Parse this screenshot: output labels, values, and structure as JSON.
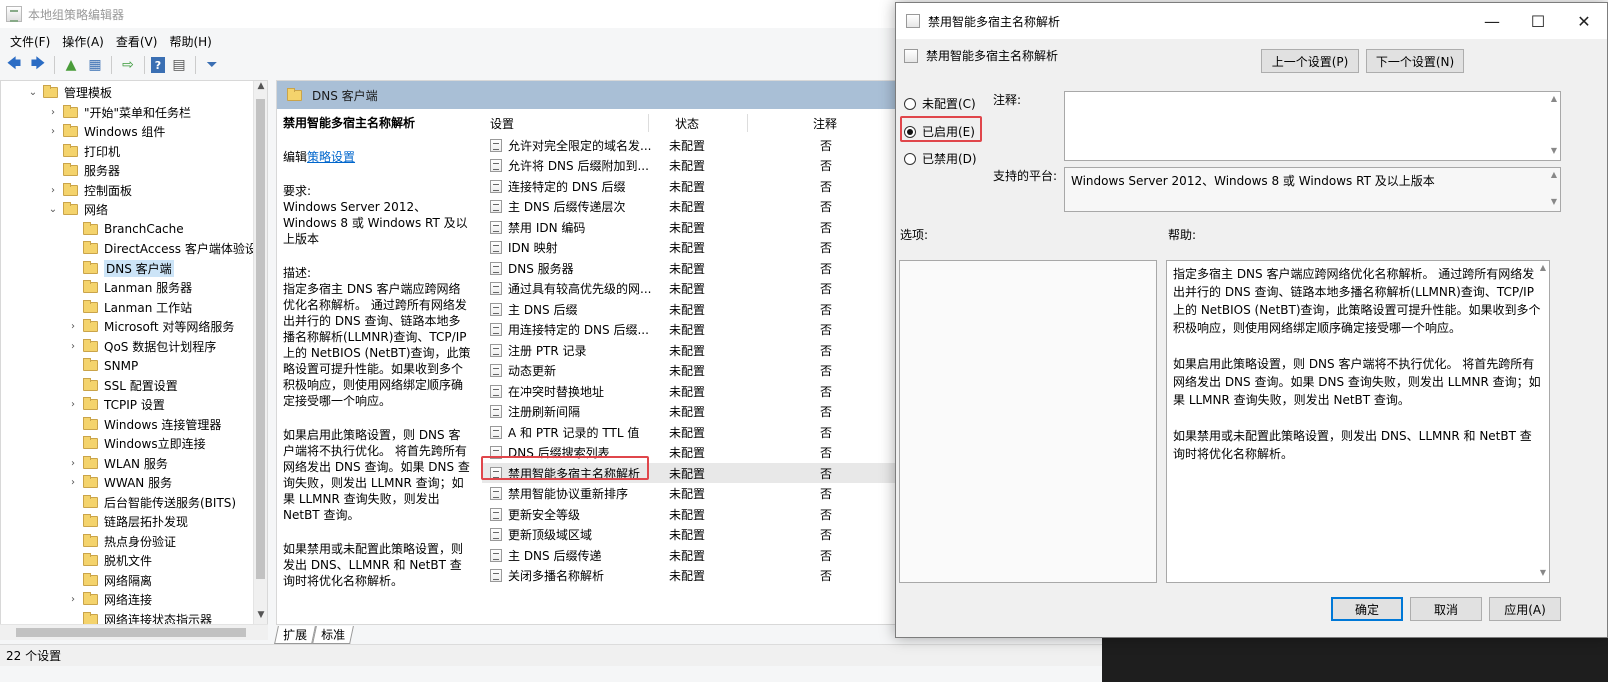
{
  "main": {
    "title": "本地组策略编辑器",
    "menu": [
      "文件(F)",
      "操作(A)",
      "查看(V)",
      "帮助(H)"
    ],
    "status": "22 个设置",
    "tabs": [
      "扩展",
      "标准"
    ]
  },
  "tree": {
    "items": [
      {
        "label": "管理模板",
        "exp": "⌄",
        "indent": 0
      },
      {
        "label": "\"开始\"菜单和任务栏",
        "exp": "›",
        "indent": 1
      },
      {
        "label": "Windows 组件",
        "exp": "›",
        "indent": 1
      },
      {
        "label": "打印机",
        "exp": "",
        "indent": 1
      },
      {
        "label": "服务器",
        "exp": "",
        "indent": 1
      },
      {
        "label": "控制面板",
        "exp": "›",
        "indent": 1
      },
      {
        "label": "网络",
        "exp": "⌄",
        "indent": 1
      },
      {
        "label": "BranchCache",
        "exp": "",
        "indent": 2
      },
      {
        "label": "DirectAccess 客户端体验设置",
        "exp": "",
        "indent": 2
      },
      {
        "label": "DNS 客户端",
        "exp": "",
        "indent": 2,
        "selected": true
      },
      {
        "label": "Lanman 服务器",
        "exp": "",
        "indent": 2
      },
      {
        "label": "Lanman 工作站",
        "exp": "",
        "indent": 2
      },
      {
        "label": "Microsoft 对等网络服务",
        "exp": "›",
        "indent": 2
      },
      {
        "label": "QoS 数据包计划程序",
        "exp": "›",
        "indent": 2
      },
      {
        "label": "SNMP",
        "exp": "",
        "indent": 2
      },
      {
        "label": "SSL 配置设置",
        "exp": "",
        "indent": 2
      },
      {
        "label": "TCPIP 设置",
        "exp": "›",
        "indent": 2
      },
      {
        "label": "Windows 连接管理器",
        "exp": "",
        "indent": 2
      },
      {
        "label": "Windows立即连接",
        "exp": "",
        "indent": 2
      },
      {
        "label": "WLAN 服务",
        "exp": "›",
        "indent": 2
      },
      {
        "label": "WWAN 服务",
        "exp": "›",
        "indent": 2
      },
      {
        "label": "后台智能传送服务(BITS)",
        "exp": "",
        "indent": 2
      },
      {
        "label": "链路层拓扑发现",
        "exp": "",
        "indent": 2
      },
      {
        "label": "热点身份验证",
        "exp": "",
        "indent": 2
      },
      {
        "label": "脱机文件",
        "exp": "",
        "indent": 2
      },
      {
        "label": "网络隔离",
        "exp": "",
        "indent": 2
      },
      {
        "label": "网络连接",
        "exp": "›",
        "indent": 2
      },
      {
        "label": "网络连接状态指示器",
        "exp": "",
        "indent": 2
      }
    ]
  },
  "content": {
    "header": "DNS 客户端",
    "desc": {
      "title": "禁用智能多宿主名称解析",
      "edit_prefix": "编辑",
      "edit_link": "策略设置",
      "req_label": "要求:",
      "req_text": "Windows Server 2012、Windows 8 或 Windows RT 及以上版本",
      "desc_label": "描述:",
      "p1": "指定多宿主 DNS 客户端应跨网络优化名称解析。 通过跨所有网络发出并行的 DNS 查询、链路本地多播名称解析(LLMNR)查询、TCP/IP 上的 NetBIOS (NetBT)查询，此策略设置可提升性能。如果收到多个积极响应，则使用网络绑定顺序确定接受哪一个响应。",
      "p2": "如果启用此策略设置，则 DNS 客户端将不执行优化。 将首先跨所有网络发出 DNS 查询。如果 DNS 查询失败，则发出 LLMNR 查询；如果 LLMNR 查询失败，则发出 NetBT 查询。",
      "p3": "如果禁用或未配置此策略设置，则发出 DNS、LLMNR 和 NetBT 查询时将优化名称解析。"
    },
    "columns": {
      "setting": "设置",
      "state": "状态",
      "note": "注释"
    },
    "rows": [
      {
        "name": "允许对完全限定的域名发...",
        "state": "未配置",
        "note": "否"
      },
      {
        "name": "允许将 DNS 后缀附加到...",
        "state": "未配置",
        "note": "否"
      },
      {
        "name": "连接特定的 DNS 后缀",
        "state": "未配置",
        "note": "否"
      },
      {
        "name": "主 DNS 后缀传递层次",
        "state": "未配置",
        "note": "否"
      },
      {
        "name": "禁用 IDN 编码",
        "state": "未配置",
        "note": "否"
      },
      {
        "name": "IDN 映射",
        "state": "未配置",
        "note": "否"
      },
      {
        "name": "DNS 服务器",
        "state": "未配置",
        "note": "否"
      },
      {
        "name": "通过具有较高优先级的网...",
        "state": "未配置",
        "note": "否"
      },
      {
        "name": "主 DNS 后缀",
        "state": "未配置",
        "note": "否"
      },
      {
        "name": "用连接特定的 DNS 后缀...",
        "state": "未配置",
        "note": "否"
      },
      {
        "name": "注册 PTR 记录",
        "state": "未配置",
        "note": "否"
      },
      {
        "name": "动态更新",
        "state": "未配置",
        "note": "否"
      },
      {
        "name": "在冲突时替换地址",
        "state": "未配置",
        "note": "否"
      },
      {
        "name": "注册刷新间隔",
        "state": "未配置",
        "note": "否"
      },
      {
        "name": "A 和 PTR 记录的 TTL 值",
        "state": "未配置",
        "note": "否"
      },
      {
        "name": "DNS 后缀搜索列表",
        "state": "未配置",
        "note": "否"
      },
      {
        "name": "禁用智能多宿主名称解析",
        "state": "未配置",
        "note": "否",
        "selected": true
      },
      {
        "name": "禁用智能协议重新排序",
        "state": "未配置",
        "note": "否"
      },
      {
        "name": "更新安全等级",
        "state": "未配置",
        "note": "否"
      },
      {
        "name": "更新顶级域区域",
        "state": "未配置",
        "note": "否"
      },
      {
        "name": "主 DNS 后缀传递",
        "state": "未配置",
        "note": "否"
      },
      {
        "name": "关闭多播名称解析",
        "state": "未配置",
        "note": "否"
      }
    ]
  },
  "dialog": {
    "title": "禁用智能多宿主名称解析",
    "subtitle": "禁用智能多宿主名称解析",
    "prev_btn": "上一个设置(P)",
    "next_btn": "下一个设置(N)",
    "radio_not_configured": "未配置(C)",
    "radio_enabled": "已启用(E)",
    "radio_disabled": "已禁用(D)",
    "selected_radio": "enabled",
    "comment_label": "注释:",
    "comment_value": "",
    "platform_label": "支持的平台:",
    "platform_value": "Windows Server 2012、Windows 8 或 Windows RT 及以上版本",
    "options_label": "选项:",
    "help_label": "帮助:",
    "help_text": "指定多宿主 DNS 客户端应跨网络优化名称解析。 通过跨所有网络发出并行的 DNS 查询、链路本地多播名称解析(LLMNR)查询、TCP/IP 上的 NetBIOS (NetBT)查询，此策略设置可提升性能。如果收到多个积极响应，则使用网络绑定顺序确定接受哪一个响应。\n\n如果启用此策略设置，则 DNS 客户端将不执行优化。 将首先跨所有网络发出 DNS 查询。如果 DNS 查询失败，则发出 LLMNR 查询；如果 LLMNR 查询失败，则发出 NetBT 查询。\n\n如果禁用或未配置此策略设置，则发出 DNS、LLMNR 和 NetBT 查询时将优化名称解析。",
    "ok_btn": "确定",
    "cancel_btn": "取消",
    "apply_btn": "应用(A)"
  },
  "colors": {
    "highlight": "#e0464b",
    "content_header": "#a9bfd6",
    "accent": "#0078d7"
  }
}
